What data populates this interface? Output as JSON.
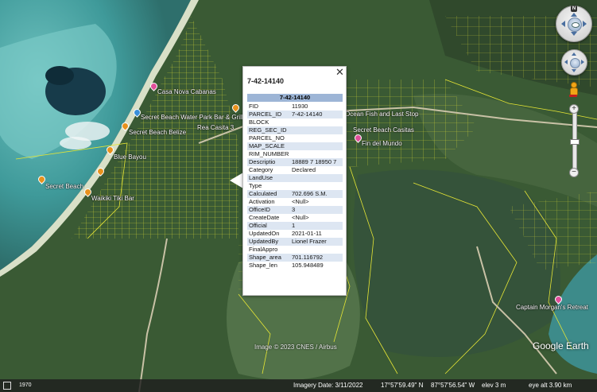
{
  "map": {
    "places": [
      {
        "label": "Casa Nova Cabanas",
        "pin": "pink"
      },
      {
        "label": "Secret Beach Water Park Bar & Grill",
        "pin": "blue"
      },
      {
        "label": "Rea Casita 3",
        "pin": "none"
      },
      {
        "label": "Secret Beach Belize",
        "pin": "orange"
      },
      {
        "label": "Blue Bayou",
        "pin": "orange"
      },
      {
        "label": "Secret Beach",
        "pin": "orange"
      },
      {
        "label": "Waikiki Tiki Bar",
        "pin": "orange"
      },
      {
        "label": "Ocean Fish and Last Stop",
        "pin": "none"
      },
      {
        "label": "Secret Beach Casitas",
        "pin": "none"
      },
      {
        "label": "Fin del Mundo",
        "pin": "pink"
      },
      {
        "label": "Captain Morgan's Retreat",
        "pin": "pink"
      }
    ],
    "credit": "Image © 2023 CNES / Airbus",
    "watermark": "Google Earth"
  },
  "popup": {
    "title": "7-42-14140",
    "close_icon": "✕",
    "header": "7-42-14140",
    "rows": [
      {
        "key": "FID",
        "value": "11930"
      },
      {
        "key": "PARCEL_ID",
        "value": "7-42-14140"
      },
      {
        "key": "BLOCK",
        "value": ""
      },
      {
        "key": "REG_SEC_ID",
        "value": ""
      },
      {
        "key": "PARCEL_NO",
        "value": ""
      },
      {
        "key": "MAP_SCALE",
        "value": ""
      },
      {
        "key": "RIM_NUMBER",
        "value": ""
      },
      {
        "key": "Descriptio",
        "value": "18889 7 18950 7"
      },
      {
        "key": "Category",
        "value": "Declared"
      },
      {
        "key": "LandUse",
        "value": ""
      },
      {
        "key": "Type",
        "value": ""
      },
      {
        "key": "Calculated",
        "value": "702.696 S.M."
      },
      {
        "key": "Activation",
        "value": "<Null>"
      },
      {
        "key": "OfficeID",
        "value": "3"
      },
      {
        "key": "CreateDate",
        "value": "<Null>"
      },
      {
        "key": "Official",
        "value": "1"
      },
      {
        "key": "UpdatedOn",
        "value": "2021-01-11"
      },
      {
        "key": "UpdatedBy",
        "value": "Lionel Frazer"
      },
      {
        "key": "FinalAppro",
        "value": ""
      },
      {
        "key": "Shape_area",
        "value": "701.116792"
      },
      {
        "key": "Shape_len",
        "value": "105.948489"
      }
    ]
  },
  "nav": {
    "north_label": "N",
    "zoom_in": "+",
    "zoom_out": "−"
  },
  "status": {
    "scale": "1970",
    "imagery_date": "Imagery Date: 3/11/2022",
    "lat": "17°57'59.49\" N",
    "lon": "87°57'56.54\" W",
    "elev": "elev    3 m",
    "eye_alt": "eye alt   3.90 km"
  },
  "colors": {
    "parcel_lines": "#e6e635",
    "water": "#4aa8a6",
    "land": "#3f5d36",
    "popup_header": "#9db5d6"
  }
}
